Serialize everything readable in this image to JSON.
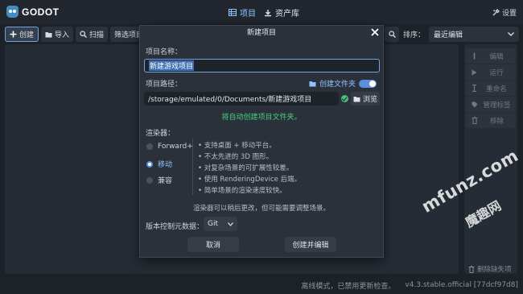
{
  "app": {
    "logo_text": "GODOT"
  },
  "topnav": {
    "projects": "项目",
    "assetlib": "资产库"
  },
  "settings_label": "设置",
  "toolbar": {
    "create": "创建",
    "import": "导入",
    "scan": "扫描",
    "filter": "筛选项目"
  },
  "sort": {
    "label": "排序：",
    "value": "最近编辑"
  },
  "side_actions": [
    "编辑",
    "运行",
    "重命名",
    "管理标签",
    "移除"
  ],
  "side_bottom": "删除缺失项",
  "status": {
    "text": "离线模式，已禁用更新检查。",
    "version": "v4.3.stable.official [77dcf97d8]"
  },
  "dialog": {
    "title": "新建项目",
    "name_label": "项目名称：",
    "name_value": "新建游戏项目",
    "path_label": "项目路径：",
    "create_folder": "创建文件夹",
    "path_value": "/storage/emulated/0/Documents/新建游戏项目",
    "browse": "浏览",
    "notice": "将自动创建项目文件夹。",
    "renderer_label": "渲染器：",
    "renderers": [
      "Forward+",
      "移动",
      "兼容"
    ],
    "selected_renderer": "移动",
    "features": [
      "• 支持桌面 + 移动平台。",
      "• 不太先进的 3D 图形。",
      "• 对复杂场景的可扩展性较差。",
      "• 使用 RenderingDevice 后端。",
      "• 简单场景的渲染速度较快。"
    ],
    "renderer_hint": "渲染器可以稍后更改，但可能需要调整场景。",
    "vcs_label": "版本控制元数据：",
    "vcs_value": "Git",
    "cancel": "取消",
    "create_edit": "创建并编辑"
  },
  "watermark": {
    "line1": "mfunz.com",
    "line2": "魔趣网"
  },
  "colors": {
    "accent": "#6fa4e4",
    "success": "#45d080",
    "background": "#1d2229"
  }
}
